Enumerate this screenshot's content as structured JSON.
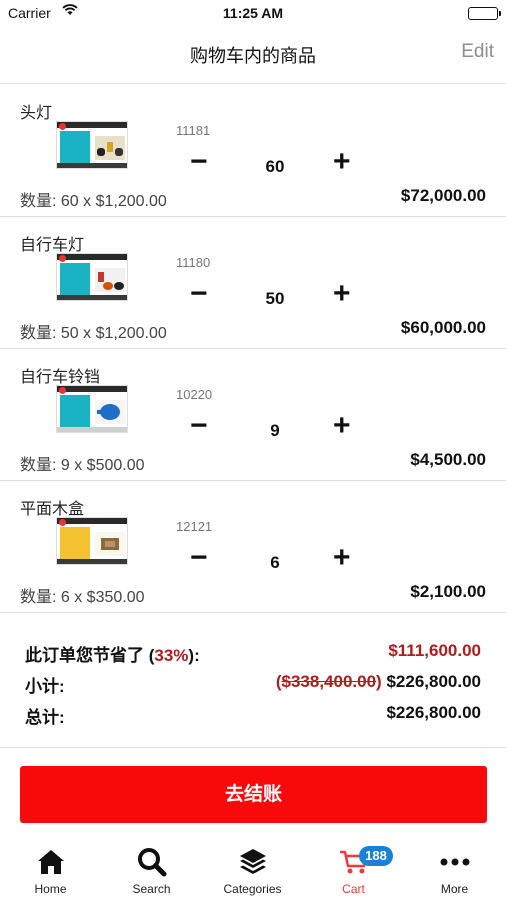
{
  "status_bar": {
    "carrier": "Carrier",
    "time": "11:25 AM"
  },
  "nav": {
    "title": "购物车内的商品",
    "edit": "Edit"
  },
  "items": [
    {
      "name": "头灯",
      "sku": "11181",
      "qty": "60",
      "qty_text": "数量: 60 x $1,200.00",
      "total": "$72,000.00",
      "minus": "−",
      "plus": "+"
    },
    {
      "name": "自行车灯",
      "sku": "11180",
      "qty": "50",
      "qty_text": "数量: 50 x $1,200.00",
      "total": "$60,000.00",
      "minus": "−",
      "plus": "+"
    },
    {
      "name": "自行车铃铛",
      "sku": "10220",
      "qty": "9",
      "qty_text": "数量: 9 x $500.00",
      "total": "$4,500.00",
      "minus": "−",
      "plus": "+"
    },
    {
      "name": "平面木盒",
      "sku": "12121",
      "qty": "6",
      "qty_text": "数量: 6 x $350.00",
      "total": "$2,100.00",
      "minus": "−",
      "plus": "+"
    }
  ],
  "summary": {
    "savings_label_prefix": "此订单您节省了 (",
    "savings_percent": "33%",
    "savings_label_suffix": "):",
    "savings_value": "$111,600.00",
    "subtotal_label": "小计:",
    "subtotal_paren_open": "(",
    "subtotal_original": "$338,400.00",
    "subtotal_paren_close": ")",
    "subtotal_value": "$226,800.00",
    "total_label": "总计:",
    "total_value": "$226,800.00"
  },
  "checkout": {
    "label": "去结账"
  },
  "tabs": [
    {
      "label": "Home",
      "icon": "home-icon"
    },
    {
      "label": "Search",
      "icon": "search-icon"
    },
    {
      "label": "Categories",
      "icon": "layers-icon"
    },
    {
      "label": "Cart",
      "icon": "cart-icon",
      "badge": "188",
      "active": true
    },
    {
      "label": "More",
      "icon": "more-icon"
    }
  ],
  "colors": {
    "accent_red": "#f80a0a",
    "price_red": "#b01c1c",
    "badge_blue": "#1a82d6",
    "active_tab": "#f03a3a"
  }
}
